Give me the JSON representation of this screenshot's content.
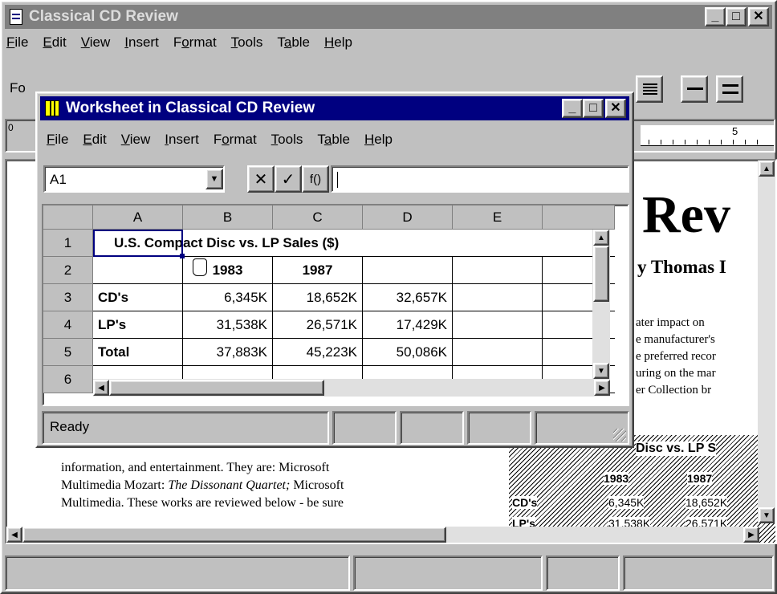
{
  "main_window": {
    "title": "Classical CD Review",
    "menu": [
      "File",
      "Edit",
      "View",
      "Insert",
      "Format",
      "Tools",
      "Table",
      "Help"
    ],
    "menu_mnemonic_index": [
      0,
      0,
      0,
      0,
      1,
      0,
      1,
      0
    ],
    "toolbar": {
      "font_label": "Fo",
      "ruler_mark": "5",
      "ruler_zero": "0"
    },
    "doc": {
      "big_title": "Rev",
      "byline": "y Thomas I",
      "right_lines": [
        "ater impact on",
        "e manufacturer's",
        "e preferred recor",
        "uring on the mar",
        "er Collection br"
      ],
      "body_lines": [
        "information, and entertainment. They are: Microsoft",
        "Multimedia Mozart: ",
        "The Dissonant Quartet;",
        " Microsoft",
        "Multimedia. These works are reviewed below - be sure"
      ],
      "embedded_table": {
        "header_text": "Disc vs. LP S",
        "years": [
          "1983",
          "1987"
        ],
        "rows": [
          [
            "CD's",
            "6,345K",
            "18,652K"
          ],
          [
            "LP's",
            "31,538K",
            "26,571K"
          ]
        ]
      }
    }
  },
  "worksheet_window": {
    "title": "Worksheet in Classical CD Review",
    "menu": [
      "File",
      "Edit",
      "View",
      "Insert",
      "Format",
      "Tools",
      "Table",
      "Help"
    ],
    "menu_mnemonic_index": [
      0,
      0,
      0,
      0,
      1,
      0,
      1,
      0
    ],
    "name_box": "A1",
    "formula_buttons": {
      "cancel": "✕",
      "enter": "✓",
      "function": "f()"
    },
    "formula_value": "",
    "columns": [
      "A",
      "B",
      "C",
      "D",
      "E",
      ""
    ],
    "rows": [
      {
        "num": "1",
        "cells": [
          "U.S. Compact Disc vs. LP Sales ($)",
          "",
          "",
          "",
          "",
          ""
        ]
      },
      {
        "num": "2",
        "cells": [
          "",
          "1983",
          "1987",
          "",
          "",
          ""
        ]
      },
      {
        "num": "3",
        "cells": [
          "CD's",
          "6,345K",
          "18,652K",
          "32,657K",
          "",
          ""
        ]
      },
      {
        "num": "4",
        "cells": [
          "LP's",
          "31,538K",
          "26,571K",
          "17,429K",
          "",
          ""
        ]
      },
      {
        "num": "5",
        "cells": [
          "Total",
          "37,883K",
          "45,223K",
          "50,086K",
          "",
          ""
        ]
      },
      {
        "num": "6",
        "cells": [
          "",
          "",
          "",
          "",
          "",
          ""
        ]
      }
    ],
    "status": "Ready"
  },
  "colors": {
    "title_active": "#000080",
    "title_inactive": "#808080",
    "face": "#c0c0c0"
  },
  "icons": [
    "document-icon",
    "worksheet-icon",
    "minimize-icon",
    "maximize-icon",
    "close-icon",
    "dropdown-arrow-icon",
    "scroll-up-icon",
    "scroll-down-icon",
    "scroll-left-icon",
    "scroll-right-icon",
    "move-cursor-icon",
    "size-grip-icon"
  ]
}
